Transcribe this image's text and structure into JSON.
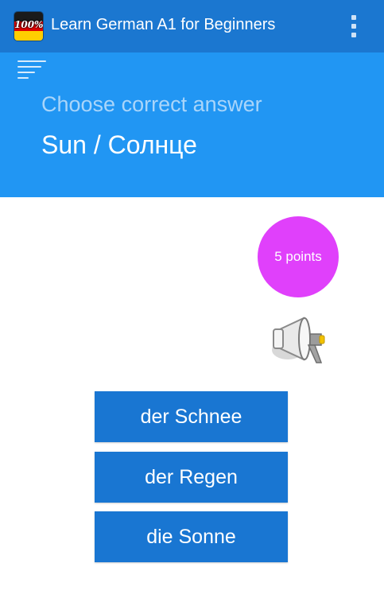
{
  "app": {
    "title": "Learn German A1 for Beginners",
    "icon_badge": "100%"
  },
  "quiz": {
    "prompt": "Choose correct answer",
    "question": "Sun / Солнце",
    "points": "5 points",
    "answers": [
      {
        "label": "der Schnee"
      },
      {
        "label": "der Regen"
      },
      {
        "label": "die Sonne"
      }
    ]
  },
  "icons": {
    "menu": "sort-menu-icon",
    "overflow": "more-vert-icon",
    "speaker": "megaphone-icon"
  },
  "colors": {
    "appbar": "#1b77d0",
    "header": "#2196f3",
    "answer_button": "#1976d2",
    "points_badge": "#e040fb"
  }
}
